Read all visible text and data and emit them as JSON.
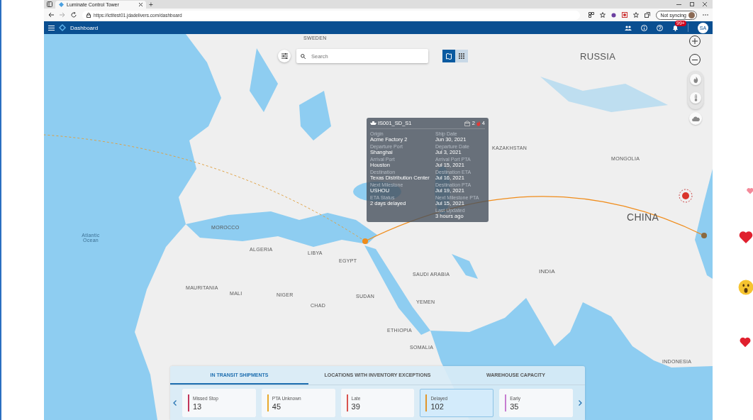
{
  "browser": {
    "tab_title": "Luminate Control Tower",
    "new_tab": "+",
    "url": "https://ictitest01.jdadelivers.com/dashboard",
    "sync_button": "Not syncing"
  },
  "app_header": {
    "title": "Dashboard",
    "notification_badge": "99+",
    "avatar_initials": "SA"
  },
  "map": {
    "search": {
      "placeholder": "Search"
    },
    "view_toggle": [
      {
        "kind": "map",
        "selected": true
      },
      {
        "kind": "grid",
        "selected": false
      }
    ],
    "labels": [
      "RUSSIA",
      "CHINA",
      "KAZAKHSTAN",
      "MONGOLIA",
      "INDIA",
      "ALGERIA",
      "LIBYA",
      "EGYPT",
      "SAUDI ARABIA",
      "SUDAN",
      "CHAD",
      "NIGER",
      "MALI",
      "MAURITANIA",
      "ETHIOPIA",
      "YEMEN",
      "SOMALIA",
      "INDONESIA",
      "MOROCCO",
      "Atlantic Ocean",
      "SWEDEN"
    ],
    "tooltip": {
      "shipment_id": "IS001_SD_S1",
      "vessel_count": "2",
      "alert_count": "4",
      "left_fields": [
        {
          "label": "Origin",
          "value": "Acme Factory 2"
        },
        {
          "label": "Departure Port",
          "value": "Shanghai"
        },
        {
          "label": "Arrival Port",
          "value": "Houston"
        },
        {
          "label": "Destination",
          "value": "Texas Distribution Center"
        },
        {
          "label": "Next Milestone",
          "value": "USHOU"
        },
        {
          "label": "ETA Status",
          "value": "2 days delayed"
        }
      ],
      "right_fields": [
        {
          "label": "Ship Date",
          "value": "Jun 30, 2021"
        },
        {
          "label": "Departure Date",
          "value": "Jul 3, 2021"
        },
        {
          "label": "Arrival Port PTA",
          "value": "Jul 15, 2021"
        },
        {
          "label": "Destination ETA",
          "value": "Jul 16, 2021"
        },
        {
          "label": "Destination PTA",
          "value": "Jul 19, 2021"
        },
        {
          "label": "Next Milestone PTA",
          "value": "Jul 15, 2021"
        },
        {
          "label": "Last Updated",
          "value": "3 hours ago"
        }
      ]
    }
  },
  "panel": {
    "tabs": [
      {
        "label": "IN TRANSIT SHIPMENTS",
        "selected": true
      },
      {
        "label": "LOCATIONS WITH INVENTORY EXCEPTIONS",
        "selected": false
      },
      {
        "label": "WAREHOUSE CAPACITY",
        "selected": false
      }
    ],
    "cards": [
      {
        "label": "Missed Stop",
        "count": "13",
        "color": "#c2365a",
        "selected": false
      },
      {
        "label": "PTA Unknown",
        "count": "45",
        "color": "#e8a92c",
        "selected": false
      },
      {
        "label": "Late",
        "count": "39",
        "color": "#d9534f",
        "selected": false
      },
      {
        "label": "Delayed",
        "count": "102",
        "color": "#e0952a",
        "selected": true
      },
      {
        "label": "Early",
        "count": "35",
        "color": "#c77dd1",
        "selected": false
      }
    ]
  },
  "reactions": [
    {
      "kind": "heart"
    },
    {
      "kind": "heart"
    },
    {
      "kind": "surprised"
    },
    {
      "kind": "heart"
    }
  ]
}
